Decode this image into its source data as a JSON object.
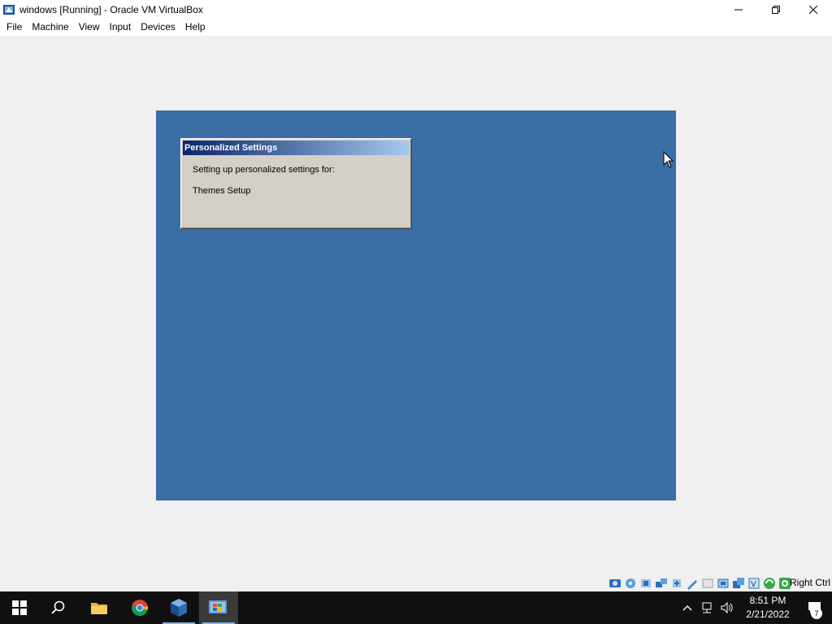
{
  "window": {
    "title": "windows [Running] - Oracle VM VirtualBox",
    "app_icon": "virtualbox-icon"
  },
  "menubar": {
    "items": [
      "File",
      "Machine",
      "View",
      "Input",
      "Devices",
      "Help"
    ]
  },
  "guest": {
    "background_color": "#3a6ea5",
    "dialog": {
      "title": "Personalized Settings",
      "line1": "Setting up personalized settings for:",
      "line2": "Themes Setup"
    }
  },
  "statusbar": {
    "icons": [
      "hard-disk-icon",
      "optical-drive-icon",
      "audio-icon",
      "network-icon",
      "usb-icon",
      "shared-folders-icon",
      "display-icon",
      "video-capture-icon",
      "screen-icon",
      "cpu-icon",
      "vt-x-icon",
      "mouse-integration-icon",
      "keyboard-icon"
    ],
    "host_key": "Right Ctrl"
  },
  "taskbar": {
    "apps": [
      "start-icon",
      "search-icon",
      "file-explorer-icon",
      "chrome-icon",
      "virtualbox-icon",
      "windows-xp-vm-icon"
    ],
    "time": "8:51 PM",
    "date": "2/21/2022",
    "notification_count": "7"
  }
}
